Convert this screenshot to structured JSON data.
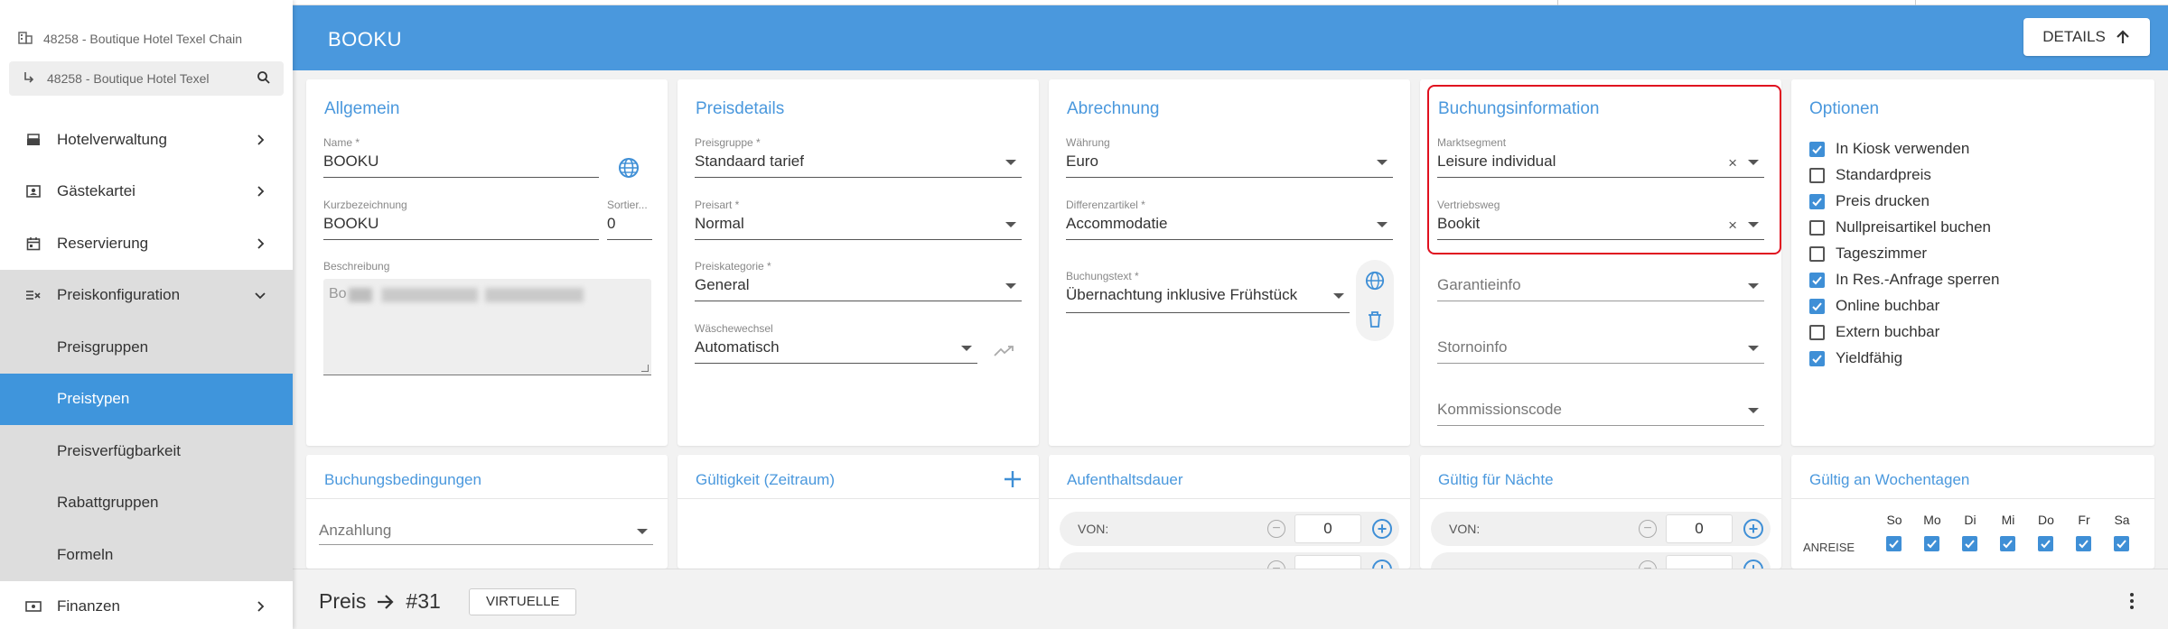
{
  "sidebar": {
    "hotel_chain": "48258 - Boutique Hotel Texel Chain",
    "hotel_selected": "48258 - Boutique Hotel Texel",
    "items": [
      {
        "label": "Hotelverwaltung"
      },
      {
        "label": "Gästekartei"
      },
      {
        "label": "Reservierung"
      },
      {
        "label": "Preiskonfiguration"
      },
      {
        "label": "Preisgruppen"
      },
      {
        "label": "Preistypen"
      },
      {
        "label": "Preisverfügbarkeit"
      },
      {
        "label": "Rabattgruppen"
      },
      {
        "label": "Formeln"
      },
      {
        "label": "Finanzen"
      }
    ]
  },
  "header": {
    "title": "BOOKU",
    "details_label": "DETAILS"
  },
  "allgemein": {
    "title": "Allgemein",
    "name_label": "Name *",
    "name_value": "BOOKU",
    "kurz_label": "Kurzbezeichnung",
    "kurz_value": "BOOKU",
    "sort_label": "Sortier...",
    "sort_value": "0",
    "beschreibung_label": "Beschreibung",
    "beschreibung_value": "Bo"
  },
  "preisdetails": {
    "title": "Preisdetails",
    "gruppe_label": "Preisgruppe *",
    "gruppe_value": "Standaard tarief",
    "art_label": "Preisart *",
    "art_value": "Normal",
    "kategorie_label": "Preiskategorie *",
    "kategorie_value": "General",
    "waesche_label": "Wäschewechsel",
    "waesche_value": "Automatisch"
  },
  "abrechnung": {
    "title": "Abrechnung",
    "waehrung_label": "Währung",
    "waehrung_value": "Euro",
    "differenz_label": "Differenzartikel *",
    "differenz_value": "Accommodatie",
    "buchungstext_label": "Buchungstext *",
    "buchungstext_value": "Übernachtung inklusive Frühstück"
  },
  "buchungsinfo": {
    "title": "Buchungsinformation",
    "markt_label": "Marktsegment",
    "markt_value": "Leisure individual",
    "vertrieb_label": "Vertriebsweg",
    "vertrieb_value": "Bookit",
    "garantie_placeholder": "Garantieinfo",
    "storno_placeholder": "Stornoinfo",
    "kommission_placeholder": "Kommissionscode",
    "highlight_color": "#e0101f"
  },
  "optionen": {
    "title": "Optionen",
    "items": [
      {
        "label": "In Kiosk verwenden",
        "checked": true
      },
      {
        "label": "Standardpreis",
        "checked": false
      },
      {
        "label": "Preis drucken",
        "checked": true
      },
      {
        "label": "Nullpreisartikel buchen",
        "checked": false
      },
      {
        "label": "Tageszimmer",
        "checked": false
      },
      {
        "label": "In Res.-Anfrage sperren",
        "checked": true
      },
      {
        "label": "Online buchbar",
        "checked": true
      },
      {
        "label": "Extern buchbar",
        "checked": false
      },
      {
        "label": "Yieldfähig",
        "checked": true
      }
    ]
  },
  "bottom_cards": {
    "buchungsbedingungen": {
      "title": "Buchungsbedingungen",
      "anzahlung_placeholder": "Anzahlung"
    },
    "gueltigkeit": {
      "title": "Gültigkeit (Zeitraum)"
    },
    "aufenthalt": {
      "title": "Aufenthaltsdauer",
      "von_label": "VON:",
      "von_value": "0"
    },
    "naechte": {
      "title": "Gültig für Nächte",
      "von_label": "VON:",
      "von_value": "0"
    },
    "wochentage": {
      "title": "Gültig an Wochentagen",
      "row_label": "ANREISE",
      "days": [
        "So",
        "Mo",
        "Di",
        "Mi",
        "Do",
        "Fr",
        "Sa"
      ]
    }
  },
  "footer": {
    "preis_label": "Preis",
    "preis_id": "#31",
    "virtuelle_label": "VIRTUELLE"
  },
  "colors": {
    "accent": "#4a98dd",
    "active_nav": "#3f95dc",
    "checkbox": "#3f8fd6"
  }
}
